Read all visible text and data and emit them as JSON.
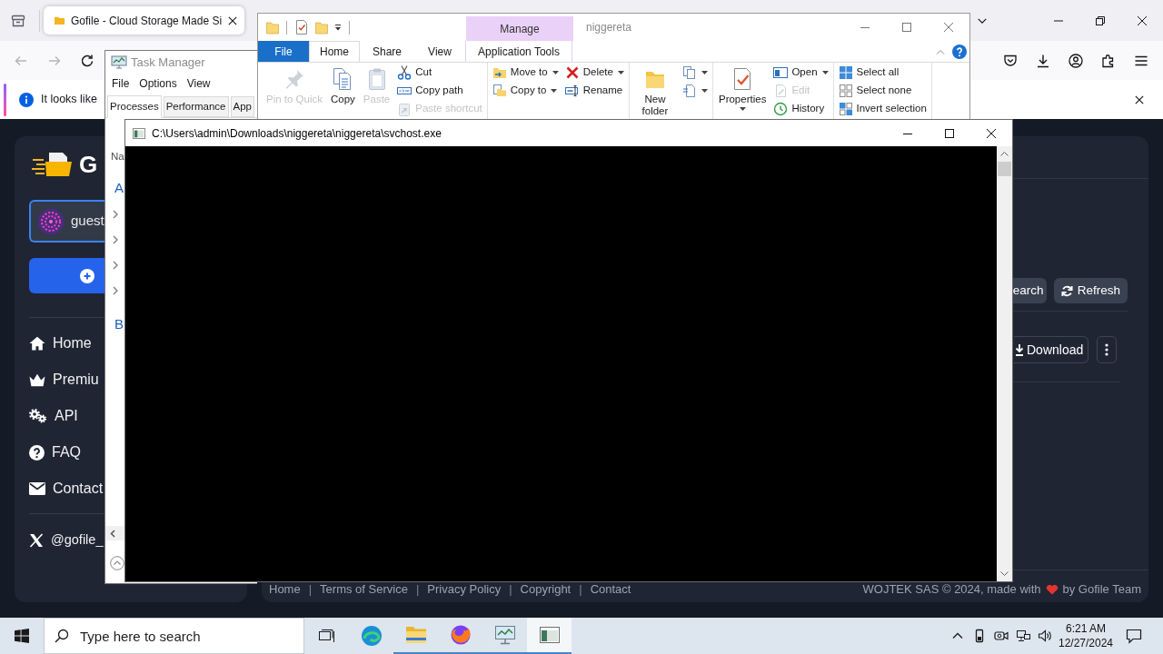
{
  "browser": {
    "tabs": [
      {
        "title": "Gofile - Cloud Storage Made Si",
        "selected": true
      }
    ],
    "notification": "It looks like"
  },
  "gofile": {
    "sidebar": {
      "logo_text": "G",
      "user": "guest",
      "nav": [
        {
          "label": "Home"
        },
        {
          "label": "Premiu"
        },
        {
          "label": "API"
        },
        {
          "label": "FAQ"
        },
        {
          "label": "Contact"
        }
      ],
      "social": "@gofile_"
    },
    "toolbar_buttons": [
      "earch",
      "Refresh"
    ],
    "download_button": "Download",
    "footer": {
      "items": [
        {
          "kind": "link",
          "text": "Home"
        },
        {
          "kind": "separator",
          "text": "|"
        },
        {
          "kind": "link",
          "text": "Terms of Service"
        },
        {
          "kind": "separator",
          "text": "|"
        },
        {
          "kind": "link",
          "text": "Privacy Policy"
        },
        {
          "kind": "separator",
          "text": "|"
        },
        {
          "kind": "link",
          "text": "Copyright"
        },
        {
          "kind": "separator",
          "text": "|"
        },
        {
          "kind": "link",
          "text": "Contact"
        }
      ],
      "credit_before": "WOJTEK SAS © 2024, made with",
      "credit_after": "by Gofile Team"
    }
  },
  "task_manager": {
    "title": "Task Manager",
    "menu": [
      "File",
      "Options",
      "View"
    ],
    "tabs": [
      {
        "label": "Processes",
        "selected": true
      },
      {
        "label": "Performance",
        "selected": false
      },
      {
        "label": "App",
        "selected": false
      }
    ],
    "column_header": "Na",
    "sections": [
      {
        "heading": "A",
        "rows": [
          {
            "expanded": false
          },
          {
            "expanded": false
          },
          {
            "expanded": false
          },
          {
            "expanded": false
          }
        ]
      },
      {
        "heading": "B"
      }
    ]
  },
  "explorer": {
    "context_tab": "Manage",
    "title": "niggereta",
    "tabs": [
      {
        "label": "File",
        "kind": "file",
        "selected": false
      },
      {
        "label": "Home",
        "kind": "tab",
        "selected": true
      },
      {
        "label": "Share",
        "kind": "tab",
        "selected": false
      },
      {
        "label": "View",
        "kind": "tab",
        "selected": false
      },
      {
        "label": "Application Tools",
        "kind": "context",
        "selected": false
      }
    ],
    "ribbon": [
      {
        "columns": [
          {
            "kind": "large",
            "items": [
              {
                "label": "Pin to Quick",
                "disabled": true,
                "dropdown": false
              }
            ]
          },
          {
            "kind": "large",
            "items": [
              {
                "label": "Copy",
                "disabled": false,
                "dropdown": false
              }
            ]
          },
          {
            "kind": "large",
            "items": [
              {
                "label": "Paste",
                "disabled": true,
                "dropdown": false
              }
            ]
          },
          {
            "kind": "small",
            "items": [
              {
                "label": "Cut",
                "disabled": false,
                "dropdown": false
              },
              {
                "label": "Copy path",
                "disabled": false,
                "dropdown": false
              },
              {
                "label": "Paste shortcut",
                "disabled": true,
                "dropdown": false
              }
            ]
          }
        ]
      },
      {
        "columns": [
          {
            "kind": "small",
            "items": [
              {
                "label": "Move to",
                "disabled": false,
                "dropdown": true
              },
              {
                "label": "Copy to",
                "disabled": false,
                "dropdown": true
              }
            ]
          },
          {
            "kind": "small",
            "items": [
              {
                "label": "Delete",
                "disabled": false,
                "dropdown": true
              },
              {
                "label": "Rename",
                "disabled": false,
                "dropdown": false
              }
            ]
          }
        ]
      },
      {
        "columns": [
          {
            "kind": "large",
            "items": [
              {
                "label": "New folder",
                "disabled": false,
                "dropdown": false
              }
            ]
          },
          {
            "kind": "small",
            "items": [
              {
                "disabled": false,
                "dropdown": true
              },
              {
                "disabled": false,
                "dropdown": true
              }
            ]
          }
        ]
      },
      {
        "columns": [
          {
            "kind": "large",
            "items": [
              {
                "label": "Properties",
                "disabled": false,
                "dropdown": true
              }
            ]
          },
          {
            "kind": "small",
            "items": [
              {
                "label": "Open",
                "disabled": false,
                "dropdown": true
              },
              {
                "label": "Edit",
                "disabled": true,
                "dropdown": false
              },
              {
                "label": "History",
                "disabled": false,
                "dropdown": false
              }
            ]
          }
        ]
      },
      {
        "columns": [
          {
            "kind": "small",
            "items": [
              {
                "label": "Select all",
                "disabled": false,
                "dropdown": false
              },
              {
                "label": "Select none",
                "disabled": false,
                "dropdown": false
              },
              {
                "label": "Invert selection",
                "disabled": false,
                "dropdown": false
              }
            ]
          }
        ]
      }
    ]
  },
  "console": {
    "title": "C:\\Users\\admin\\Downloads\\niggereta\\niggereta\\svchost.exe"
  },
  "taskbar": {
    "search_placeholder": "Type here to search",
    "apps": [
      {
        "running": false,
        "selected": false
      },
      {
        "running": true,
        "selected": false
      },
      {
        "running": true,
        "selected": false
      },
      {
        "running": true,
        "selected": false
      },
      {
        "running": true,
        "selected": true
      }
    ],
    "time": "6:21 AM",
    "date": "12/27/2024"
  }
}
